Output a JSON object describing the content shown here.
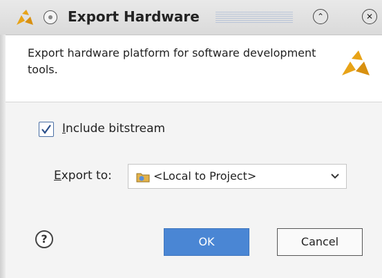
{
  "window": {
    "title": "Export Hardware",
    "minmax_glyph": "⌃",
    "close_glyph": "✕"
  },
  "header": {
    "description": "Export hardware platform for software development tools."
  },
  "options": {
    "include_bitstream": {
      "checked": true,
      "label_mnemonic": "I",
      "label_rest": "nclude bitstream"
    },
    "export_to": {
      "label_mnemonic": "E",
      "label_rest": "xport to:",
      "selected_value": "<Local to Project>"
    }
  },
  "footer": {
    "help_glyph": "?",
    "ok_label": "OK",
    "cancel_label": "Cancel"
  },
  "colors": {
    "accent": "#4a86d4",
    "logo": "#e8a317"
  },
  "icons": {
    "app": "xilinx-logo-icon",
    "folder": "folder-icon",
    "dropdown": "chevron-down-icon",
    "help": "help-icon"
  }
}
